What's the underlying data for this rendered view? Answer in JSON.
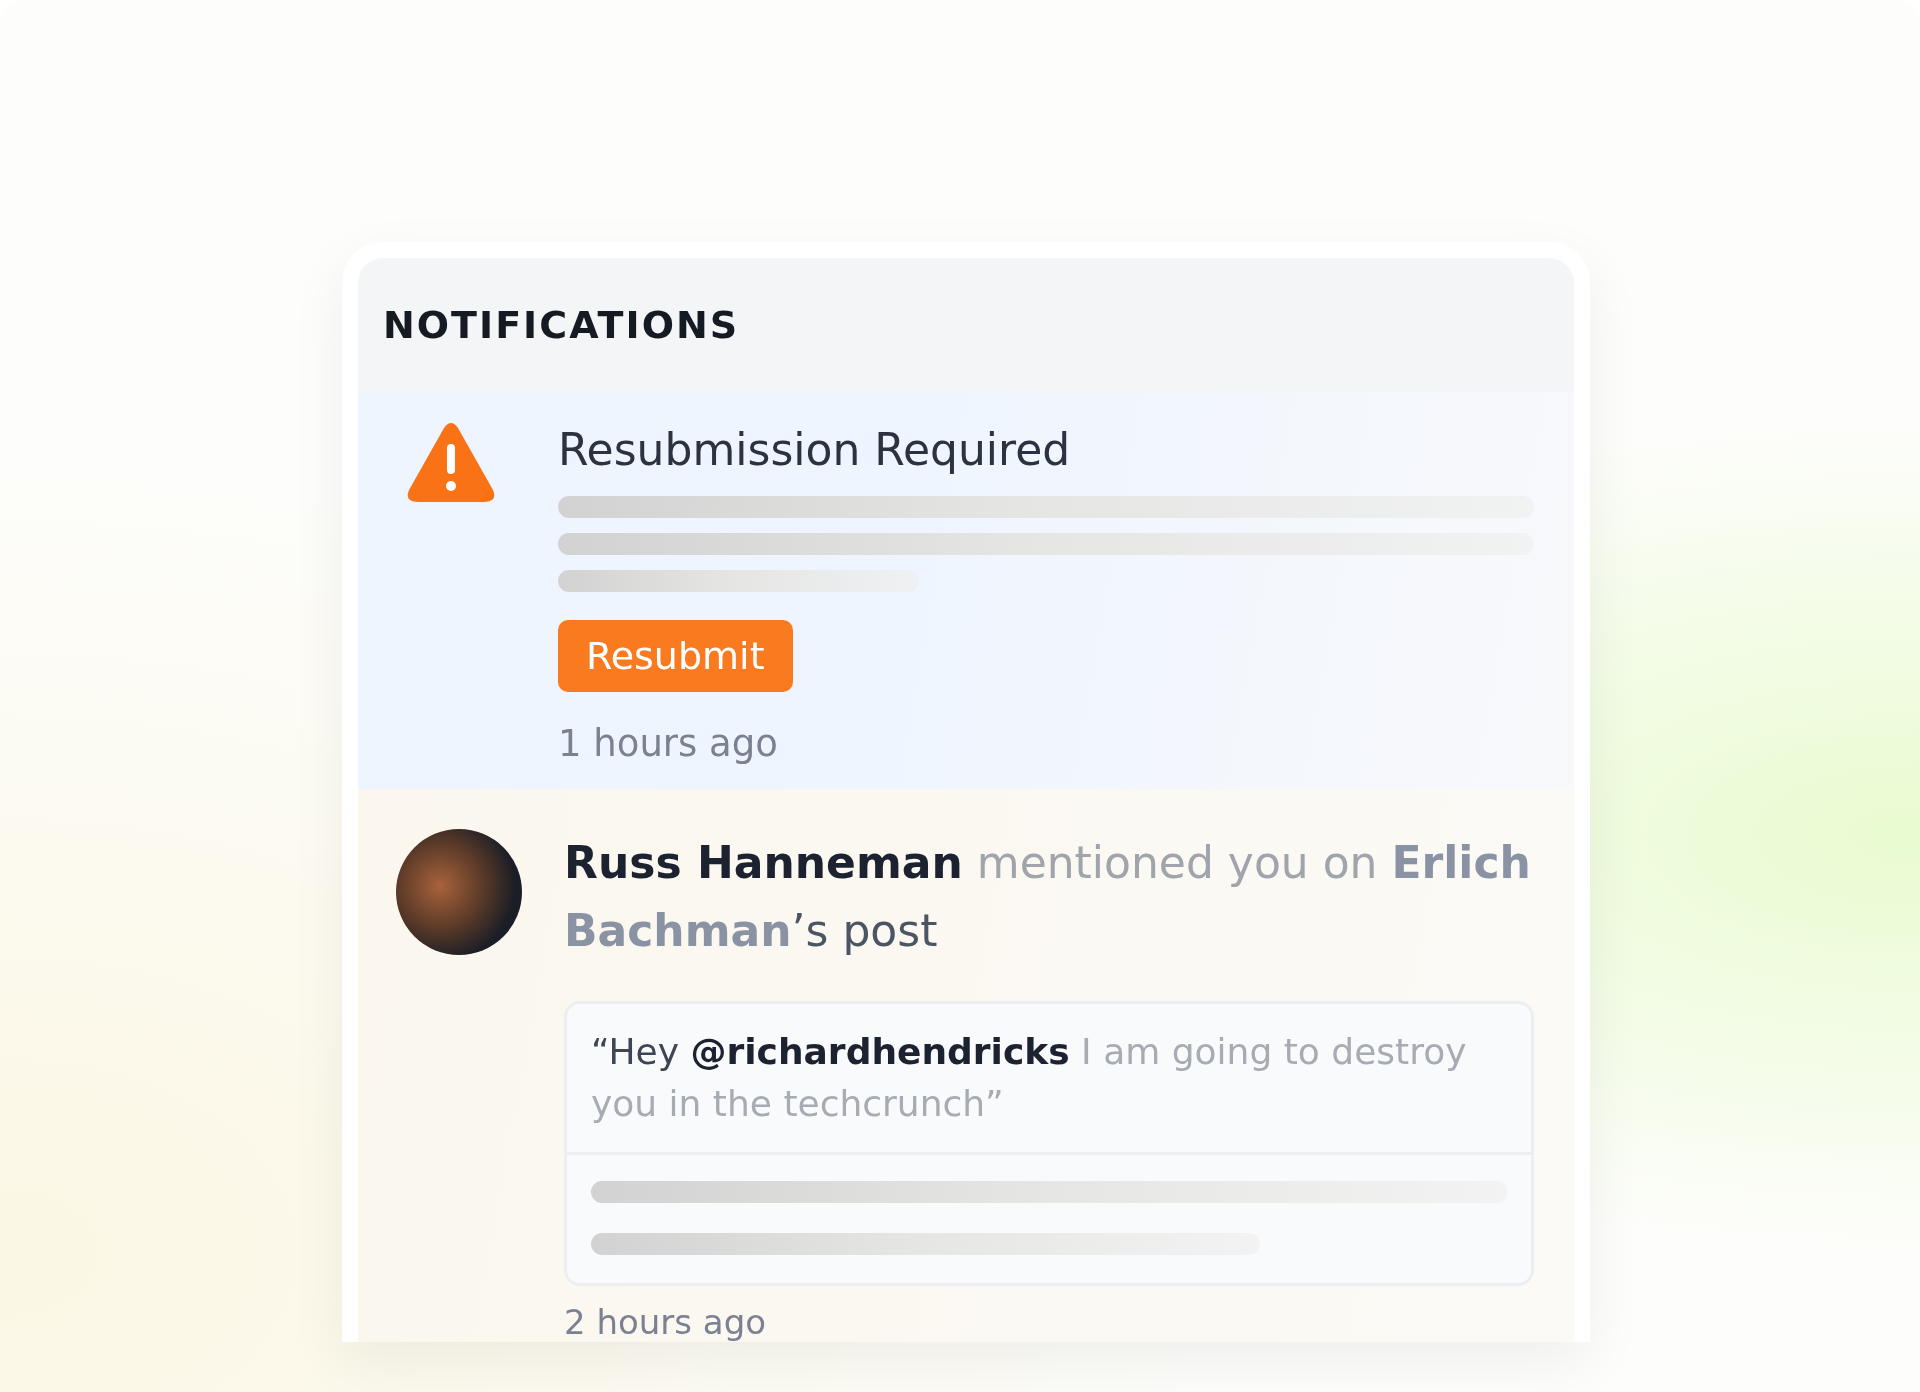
{
  "panel": {
    "title": "NOTIFICATIONS"
  },
  "notifications": [
    {
      "kind": "alert",
      "title": "Resubmission Required",
      "button": "Resubmit",
      "time": "1 hours ago"
    },
    {
      "kind": "mention",
      "message": [
        {
          "kind": "actor",
          "text": "Russ Hanneman"
        },
        {
          "kind": "plain",
          "text": " mentioned you on "
        },
        {
          "kind": "target",
          "text": "Erlich Bachman"
        },
        {
          "kind": "rest",
          "text": "’s post"
        }
      ],
      "quote": [
        {
          "kind": "rest",
          "text": "“Hey "
        },
        {
          "kind": "actor",
          "text": "@richardhendricks"
        },
        {
          "kind": "plain",
          "text": " I am going to destroy you in the techcrunch”"
        }
      ],
      "time": "2 hours ago"
    }
  ]
}
